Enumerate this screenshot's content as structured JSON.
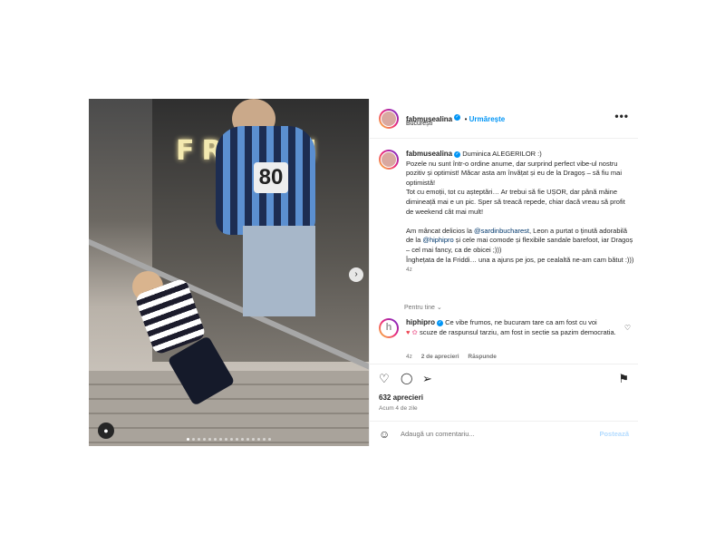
{
  "post": {
    "author": "fabmusealina",
    "follow_label": "Urmărește",
    "location": "București",
    "more_icon": "more-horizontal-icon",
    "caption": {
      "author": "fabmusealina",
      "title": "Duminica ALEGERILOR :)",
      "p1": "Pozele nu sunt într-o ordine anume, dar surprind perfect vibe-ul nostru pozitiv și optimist! Măcar asta am învățat și eu de la Dragoș – să fiu mai optimistă!\nTot cu emoții, tot cu așteptări… Ar trebui să fie UȘOR, dar până mâine dimineață mai e un pic. Sper să treacă repede, chiar dacă vreau să profit de weekend cât mai mult!",
      "p2_a": "Am mâncat delicios la ",
      "mention1": "@sardinbucharest",
      "p2_b": ", Leon a purtat o ținută adorabilă de la ",
      "mention2": "@hiphipro",
      "p2_c": " și cele mai comode și flexibile sandale barefoot, iar Dragoș – cel mai fancy, ca de obicei ;)))\nÎnghețata de la Friddi… una a ajuns pe jos, pe cealaltă ne-am cam bătut :)))",
      "time": "4z"
    },
    "for_you": "Pentru tine",
    "comment": {
      "author": "hiphipro",
      "text": "Ce vibe frumos, ne bucuram tare ca am fost cu voi",
      "text2": "scuze de raspunsul tarziu, am fost in sectie sa pazim democratia.",
      "time": "4z",
      "likes": "2 de aprecieri",
      "reply": "Răspunde"
    },
    "likes": "632 aprecieri",
    "date": "Acum 4 de zile",
    "add_comment_placeholder": "Adaugă un comentariu...",
    "post_button": "Postează",
    "photo": {
      "neon_sign": "FRIDDI",
      "jersey_number": "80"
    },
    "carousel": {
      "total": 16,
      "active": 0
    }
  },
  "colors": {
    "accent": "#0095f6",
    "link": "#00376b",
    "muted": "#737373",
    "disabled_post": "#b3dbff"
  }
}
